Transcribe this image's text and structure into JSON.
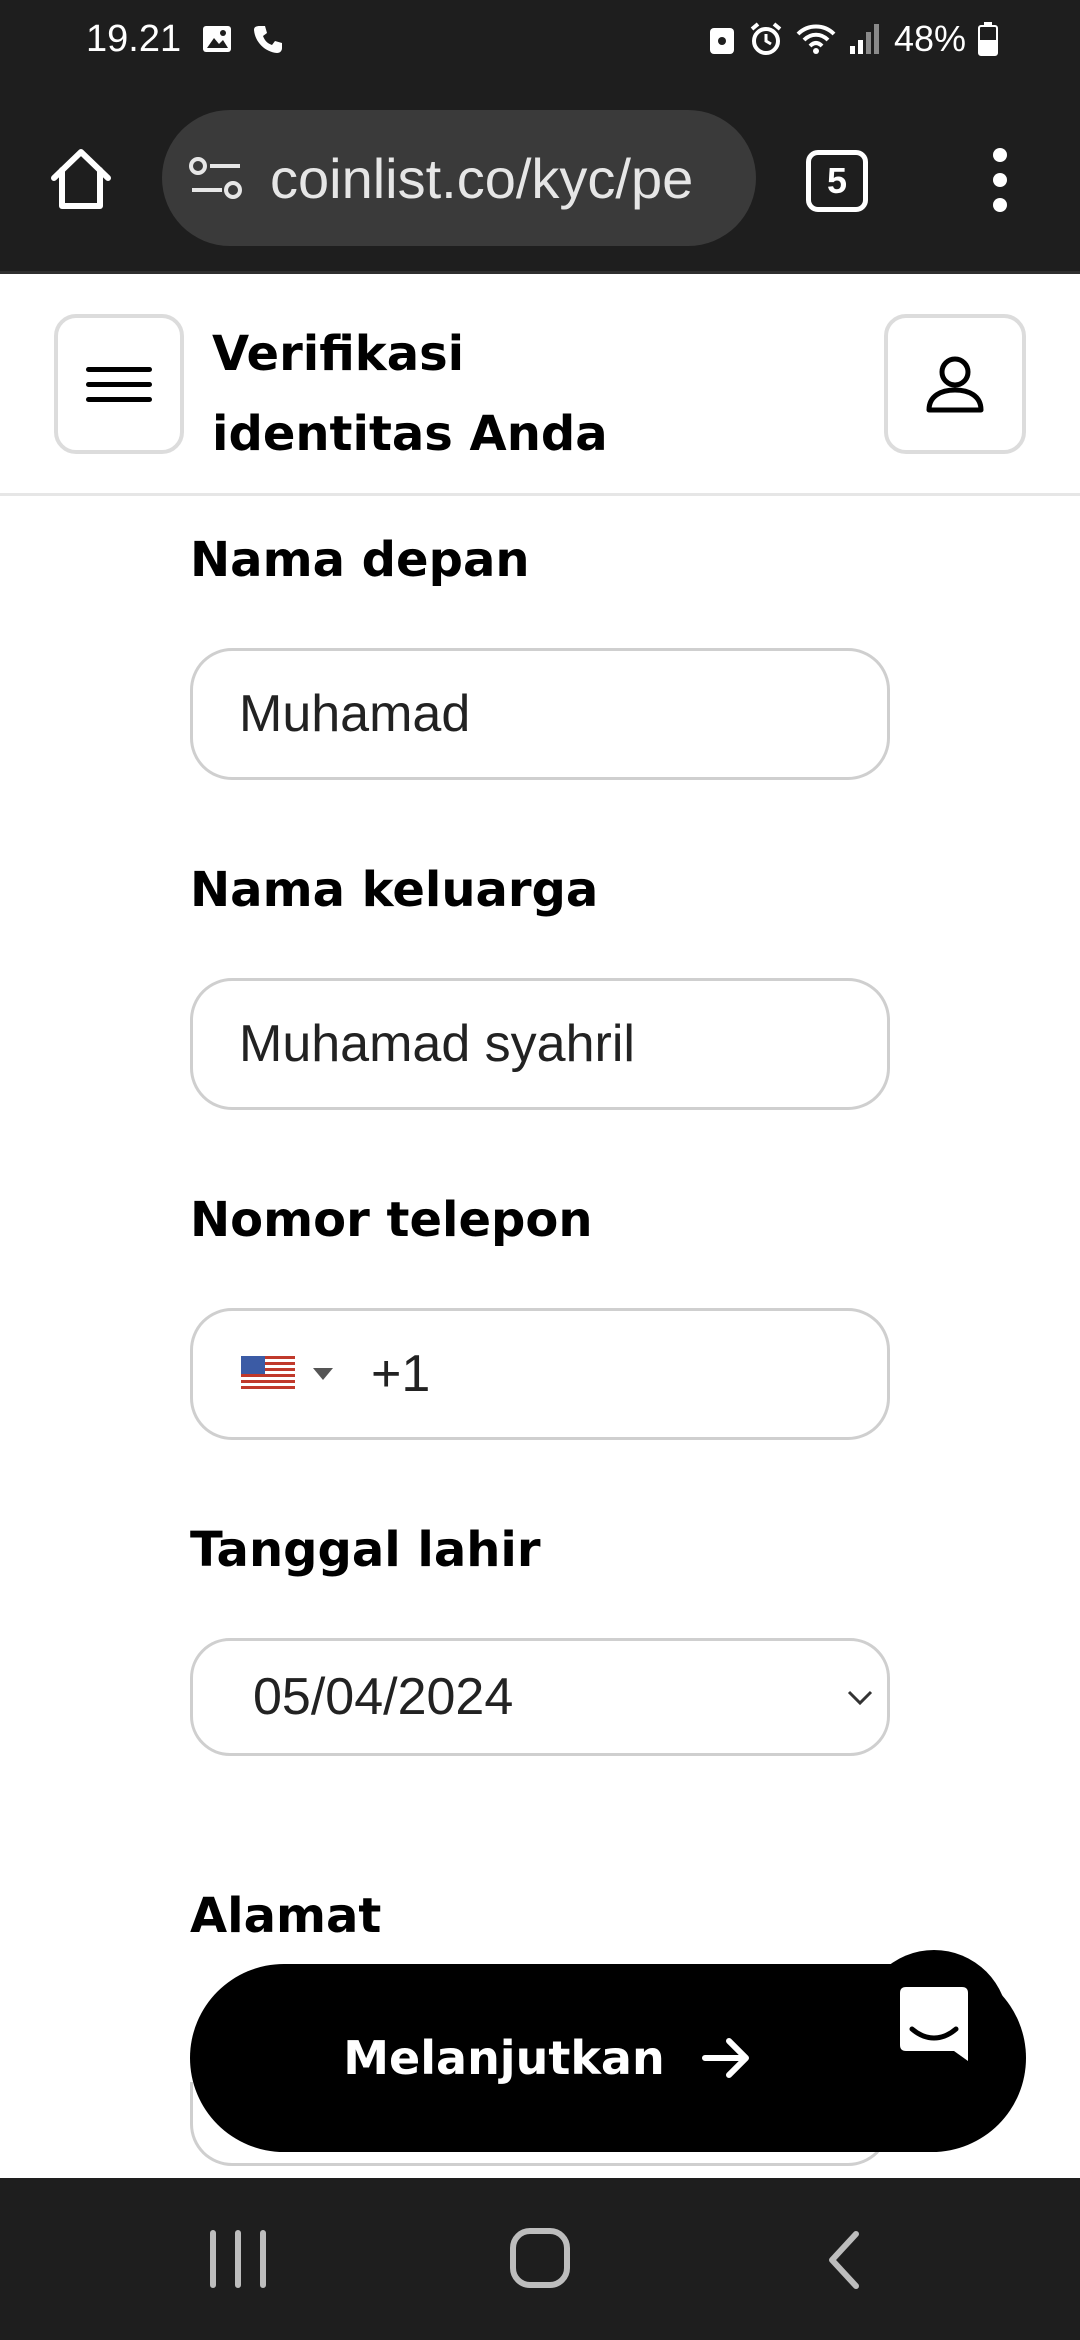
{
  "status_bar": {
    "time": "19.21",
    "battery": "48%"
  },
  "browser": {
    "url": "coinlist.co/kyc/pe",
    "tab_count": "5"
  },
  "header": {
    "title": "Verifikasi identitas Anda"
  },
  "form": {
    "first_name": {
      "label": "Nama depan",
      "value": "Muhamad"
    },
    "last_name": {
      "label": "Nama keluarga",
      "value": "Muhamad syahril"
    },
    "phone": {
      "label": "Nomor telepon",
      "value": "+1",
      "country": "US"
    },
    "birth_date": {
      "label": "Tanggal lahir",
      "value": "05/04/2024"
    },
    "address": {
      "label": "Alamat"
    }
  },
  "actions": {
    "continue_label": "Melanjutkan"
  },
  "icons": {
    "home": "home-icon",
    "site_settings": "site-settings-icon",
    "menu": "more-vert-icon",
    "hamburger": "hamburger-icon",
    "profile": "user-icon",
    "arrow": "arrow-right-icon",
    "chat": "chat-icon"
  },
  "colors": {
    "system_bar": "#1e1e1e",
    "button": "#000000",
    "input_border": "#cfcfcf"
  }
}
